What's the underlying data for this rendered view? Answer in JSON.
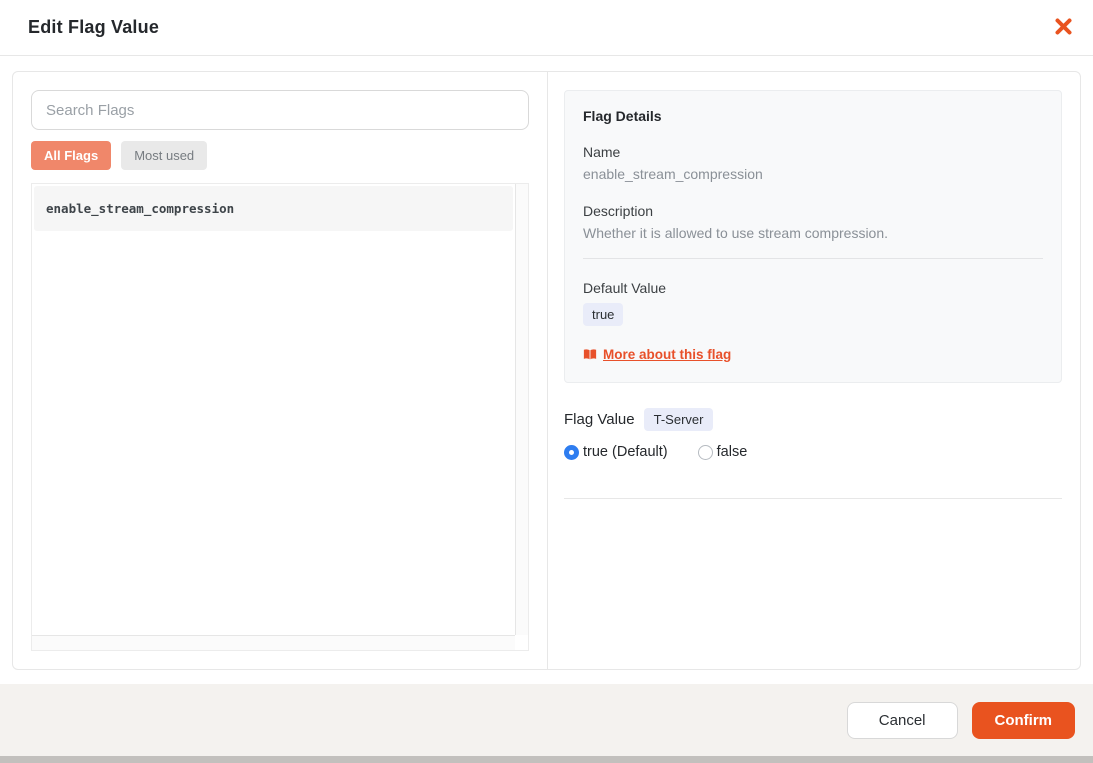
{
  "dialog": {
    "title": "Edit Flag Value"
  },
  "left_panel": {
    "search": {
      "placeholder": "Search Flags",
      "value": ""
    },
    "tabs": [
      {
        "label": "All Flags",
        "active": true
      },
      {
        "label": "Most used",
        "active": false
      }
    ],
    "flags": [
      "enable_stream_compression"
    ]
  },
  "details": {
    "heading": "Flag Details",
    "name_label": "Name",
    "name_value": "enable_stream_compression",
    "description_label": "Description",
    "description_value": "Whether it is allowed to use stream compression.",
    "default_value_label": "Default Value",
    "default_value": "true",
    "more_link_label": "More about this flag"
  },
  "flag_value": {
    "label": "Flag Value",
    "scope_badge": "T-Server",
    "options": [
      {
        "label": "true (Default)",
        "selected": true
      },
      {
        "label": "false",
        "selected": false
      }
    ]
  },
  "footer": {
    "cancel_label": "Cancel",
    "confirm_label": "Confirm"
  },
  "colors": {
    "primary_orange": "#e9531f",
    "tab_active_salmon": "#f0876a",
    "radio_blue": "#2e7df0",
    "badge_bg": "#e9ecf9",
    "footer_bg": "#f4f2ef"
  }
}
